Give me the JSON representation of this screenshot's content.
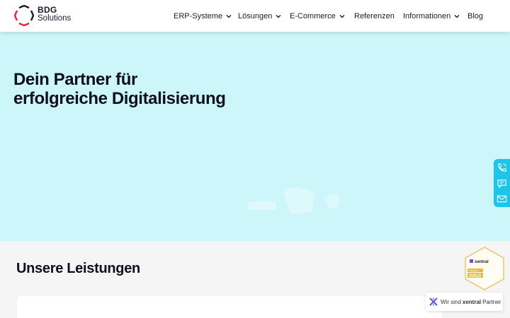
{
  "header": {
    "logo": {
      "line1": "BDG",
      "line2": "Solutions"
    },
    "nav": [
      {
        "label": "ERP-Systeme",
        "has_dropdown": true
      },
      {
        "label": "Lösungen",
        "has_dropdown": true
      },
      {
        "label": "E-Commerce",
        "has_dropdown": true
      },
      {
        "label": "Referenzen",
        "has_dropdown": false
      },
      {
        "label": "Informationen",
        "has_dropdown": true
      },
      {
        "label": "Blog",
        "has_dropdown": false
      }
    ]
  },
  "hero": {
    "title_line1": "Dein Partner für",
    "title_line2": "erfolgreiche Digitalisierung",
    "background": "#cdf6fb"
  },
  "side_contact": {
    "icons": [
      "phone-icon",
      "chat-icon",
      "mail-icon"
    ],
    "color": "#1ec5e8"
  },
  "section": {
    "title": "Unsere Leistungen"
  },
  "partner_badge": {
    "brand": "xentral",
    "tier_label": "Partner",
    "tier": "GOLD"
  },
  "partner_pill": {
    "prefix": "Wir sind",
    "brand": "xentral",
    "suffix": "Partner"
  },
  "colors": {
    "accent": "#1ec5e8",
    "logo_red": "#e3243b",
    "logo_dark": "#1a1a2e",
    "gold": "#e8b93a"
  }
}
